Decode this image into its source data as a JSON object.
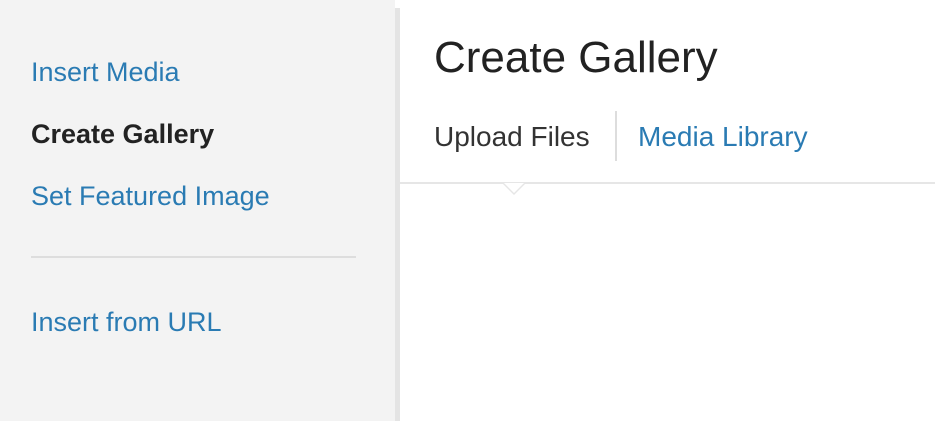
{
  "sidebar": {
    "items": [
      {
        "label": "Insert Media"
      },
      {
        "label": "Create Gallery"
      },
      {
        "label": "Set Featured Image"
      },
      {
        "label": "Insert from URL"
      }
    ]
  },
  "main": {
    "title": "Create Gallery",
    "tabs": [
      {
        "label": "Upload Files"
      },
      {
        "label": "Media Library"
      }
    ]
  },
  "colors": {
    "link": "#2a7bb3",
    "text": "#222222",
    "sidebar_bg": "#f3f3f3"
  }
}
